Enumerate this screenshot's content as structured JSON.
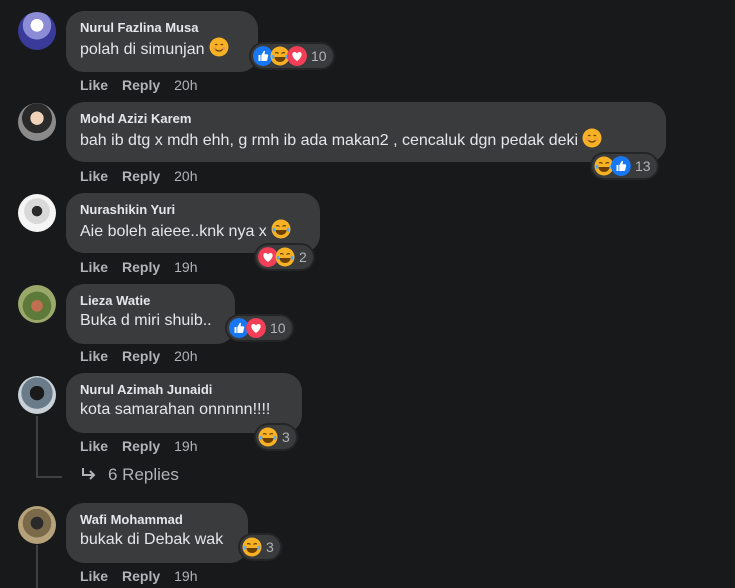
{
  "comments": [
    {
      "author": "Nurul Fazlina Musa",
      "text": "polah di simunjan",
      "like": "Like",
      "reply": "Reply",
      "time": "20h",
      "reaction_count": "10"
    },
    {
      "author": "Mohd Azizi Karem",
      "text": "bah ib dtg x mdh ehh, g rmh ib ada makan2 , cencaluk dgn pedak deki",
      "like": "Like",
      "reply": "Reply",
      "time": "20h",
      "reaction_count": "13"
    },
    {
      "author": "Nurashikin Yuri",
      "text": "Aie boleh aieee..knk nya x",
      "like": "Like",
      "reply": "Reply",
      "time": "19h",
      "reaction_count": "2"
    },
    {
      "author": "Lieza Watie",
      "text": "Buka d miri shuib..",
      "like": "Like",
      "reply": "Reply",
      "time": "20h",
      "reaction_count": "10"
    },
    {
      "author": "Nurul Azimah Junaidi",
      "text": "kota samarahan onnnnn!!!!",
      "like": "Like",
      "reply": "Reply",
      "time": "19h",
      "reaction_count": "3"
    },
    {
      "author": "Wafi Mohammad",
      "text": "bukak di Debak wak",
      "like": "Like",
      "reply": "Reply",
      "time": "19h",
      "reaction_count": "3"
    }
  ],
  "replies_label": "6 Replies",
  "colors": {
    "like_blue": "#1877f2",
    "love_red": "#f33e58",
    "haha_yellow": "#f7b125",
    "bubble": "#3a3b3c",
    "bg": "#18191a"
  },
  "icons": {
    "like": "like-react-icon",
    "love": "love-react-icon",
    "haha": "haha-react-icon",
    "smile": "smile-emoji-icon",
    "reply_arrow": "reply-arrow-icon"
  }
}
